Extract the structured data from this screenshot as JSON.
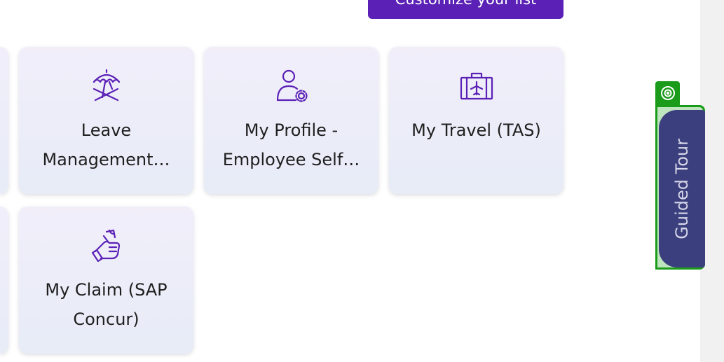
{
  "header": {
    "customize_label": "Customize your list"
  },
  "tiles": [
    {
      "label": "Leave Management…",
      "icon": "beach-umbrella-icon"
    },
    {
      "label": "My Profile - Employee Self…",
      "icon": "user-settings-icon"
    },
    {
      "label": "My Travel (TAS)",
      "icon": "suitcase-plane-icon"
    },
    {
      "label": "My Claim (SAP Concur)",
      "icon": "money-hand-icon"
    }
  ],
  "guided_tour": {
    "label": "Guided Tour"
  },
  "colors": {
    "accent": "#5b21b6",
    "icon": "#5b21b6",
    "tour_tab": "#3c3f7e",
    "tour_border": "#1a9b1a"
  }
}
